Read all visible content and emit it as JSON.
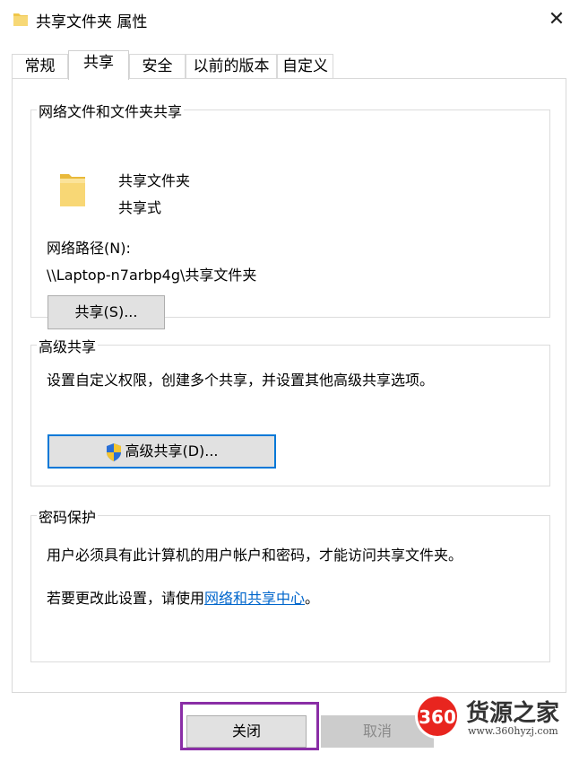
{
  "window": {
    "title": "共享文件夹 属性",
    "close_glyph": "✕"
  },
  "tabs": [
    {
      "label": "常规",
      "active": false
    },
    {
      "label": "共享",
      "active": true
    },
    {
      "label": "安全",
      "active": false
    },
    {
      "label": "以前的版本",
      "active": false
    },
    {
      "label": "自定义",
      "active": false
    }
  ],
  "network_sharing": {
    "group_title": "网络文件和文件夹共享",
    "folder_name": "共享文件夹",
    "share_status": "共享式",
    "path_label": "网络路径(N):",
    "path_value": "\\\\Laptop-n7arbp4g\\共享文件夹",
    "share_button": "共享(S)..."
  },
  "advanced_sharing": {
    "group_title": "高级共享",
    "description": "设置自定义权限，创建多个共享，并设置其他高级共享选项。",
    "button": "高级共享(D)..."
  },
  "password_protection": {
    "group_title": "密码保护",
    "line1": "用户必须具有此计算机的用户帐户和密码，才能访问共享文件夹。",
    "line2_prefix": "若要更改此设置，请使用",
    "line2_link": "网络和共享中心",
    "line2_suffix": "。"
  },
  "footer": {
    "close_button": "关闭",
    "cancel_button": "取消"
  },
  "watermark": {
    "logo_text": "360",
    "name": "货源之家",
    "url": "www.360hyzj.com"
  },
  "colors": {
    "link": "#0066cc",
    "highlight": "#8a2ea6",
    "watermark_red": "#e8251f"
  }
}
